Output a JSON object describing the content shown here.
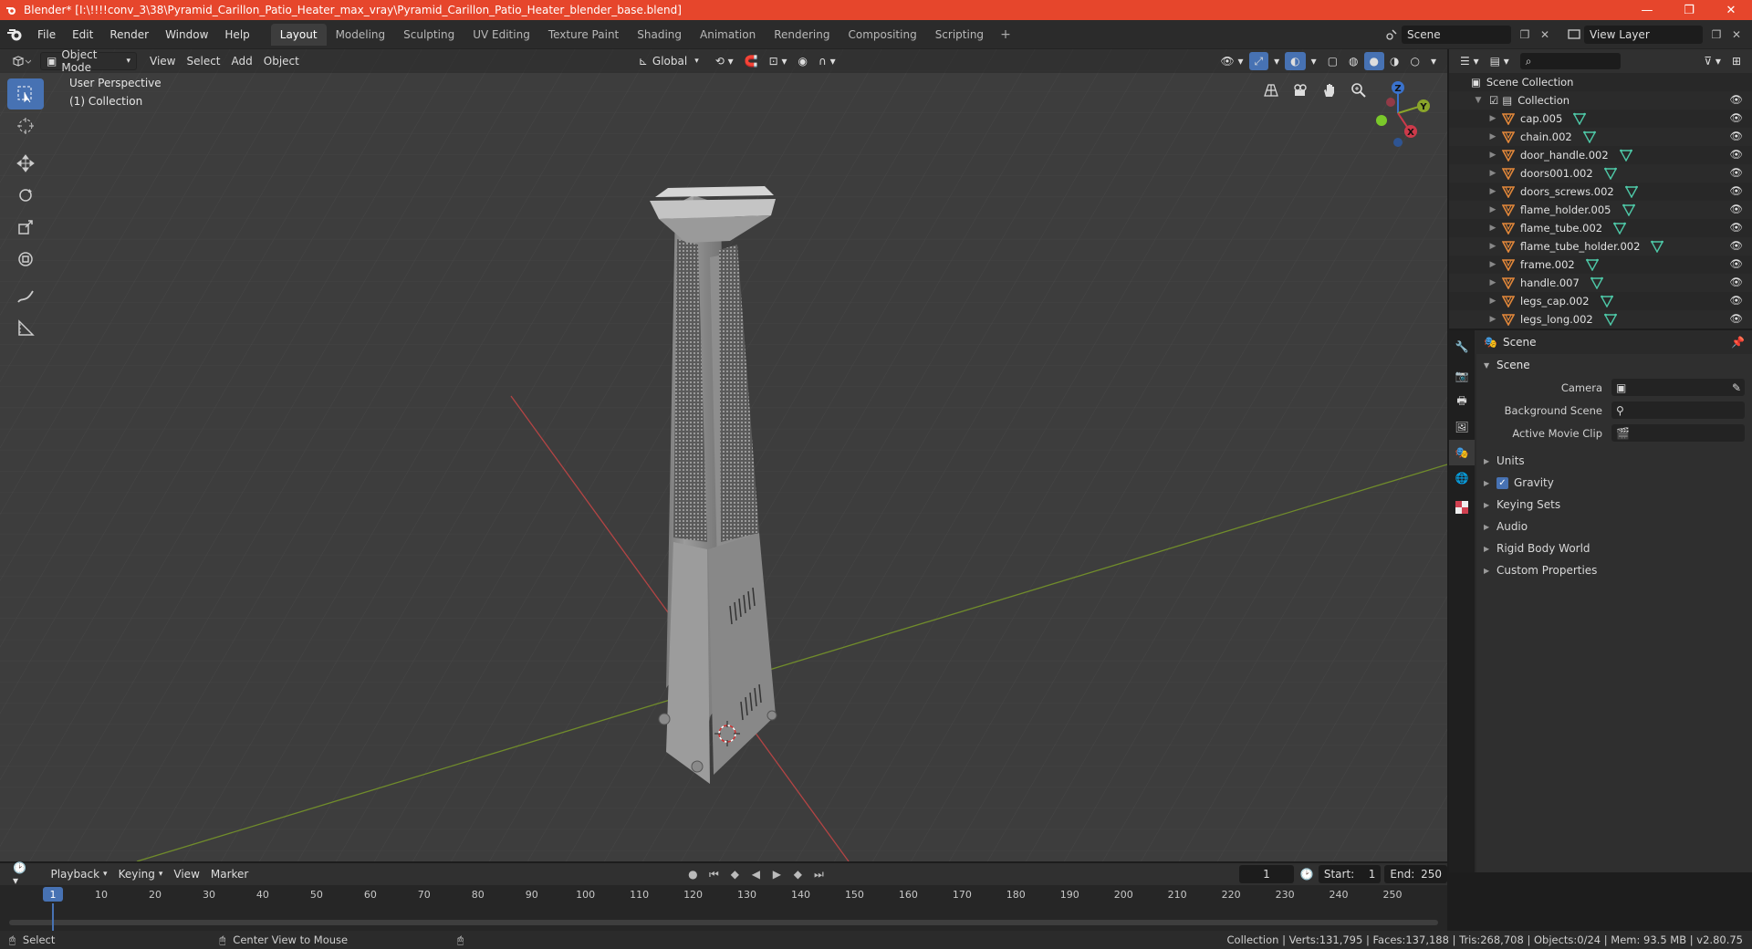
{
  "window": {
    "title": "Blender* [I:\\!!!!conv_3\\38\\Pyramid_Carillon_Patio_Heater_max_vray\\Pyramid_Carillon_Patio_Heater_blender_base.blend]",
    "controls": [
      "—",
      "❐",
      "✕"
    ]
  },
  "menu": [
    "File",
    "Edit",
    "Render",
    "Window",
    "Help"
  ],
  "workspaces": [
    "Layout",
    "Modeling",
    "Sculpting",
    "UV Editing",
    "Texture Paint",
    "Shading",
    "Animation",
    "Rendering",
    "Compositing",
    "Scripting"
  ],
  "workspace_add": "+",
  "scene_field": "Scene",
  "view_layer_field": "View Layer",
  "viewport": {
    "mode": "Object Mode",
    "menus": [
      "View",
      "Select",
      "Add",
      "Object"
    ],
    "orientation": "Global",
    "perspective_label": "User Perspective",
    "collection_label": "(1) Collection",
    "gizmo_axes": {
      "z": "Z",
      "y": "Y",
      "x": "X"
    }
  },
  "tools": [
    "select-box-icon",
    "cursor-icon",
    "move-icon",
    "rotate-icon",
    "scale-icon",
    "transform-icon",
    "annotate-icon",
    "measure-icon"
  ],
  "outliner": {
    "root": "Scene Collection",
    "collection": "Collection",
    "objects": [
      "cap.005",
      "chain.002",
      "door_handle.002",
      "doors001.002",
      "doors_screws.002",
      "flame_holder.005",
      "flame_tube.002",
      "flame_tube_holder.002",
      "frame.002",
      "handle.007",
      "legs_cap.002",
      "legs_long.002"
    ]
  },
  "properties": {
    "header": "Scene",
    "panel": "Scene",
    "rows": [
      {
        "label": "Camera"
      },
      {
        "label": "Background Scene"
      },
      {
        "label": "Active Movie Clip"
      }
    ],
    "subpanels": [
      "Units",
      "Gravity",
      "Keying Sets",
      "Audio",
      "Rigid Body World",
      "Custom Properties"
    ],
    "gravity_checked": true
  },
  "timeline": {
    "menus": [
      "Playback",
      "Keying",
      "View",
      "Marker"
    ],
    "current_frame": "1",
    "start_label": "Start:",
    "start": "1",
    "end_label": "End:",
    "end": "250",
    "ticks": [
      "1",
      "10",
      "20",
      "30",
      "40",
      "50",
      "60",
      "70",
      "80",
      "90",
      "100",
      "110",
      "120",
      "130",
      "140",
      "150",
      "160",
      "170",
      "180",
      "190",
      "200",
      "210",
      "220",
      "230",
      "240",
      "250"
    ]
  },
  "status": {
    "left": "Select",
    "mid": "Center View to Mouse",
    "right": "Collection | Verts:131,795 | Faces:137,188 | Tris:268,708 | Objects:0/24 | Mem: 93.5 MB | v2.80.75"
  },
  "colors": {
    "accent": "#4772b3",
    "titlebar": "#e6462c",
    "x_axis": "#c84646",
    "y_axis": "#7a9a28",
    "object_orange": "#e3883a",
    "mesh_green": "#4ec9a8"
  }
}
